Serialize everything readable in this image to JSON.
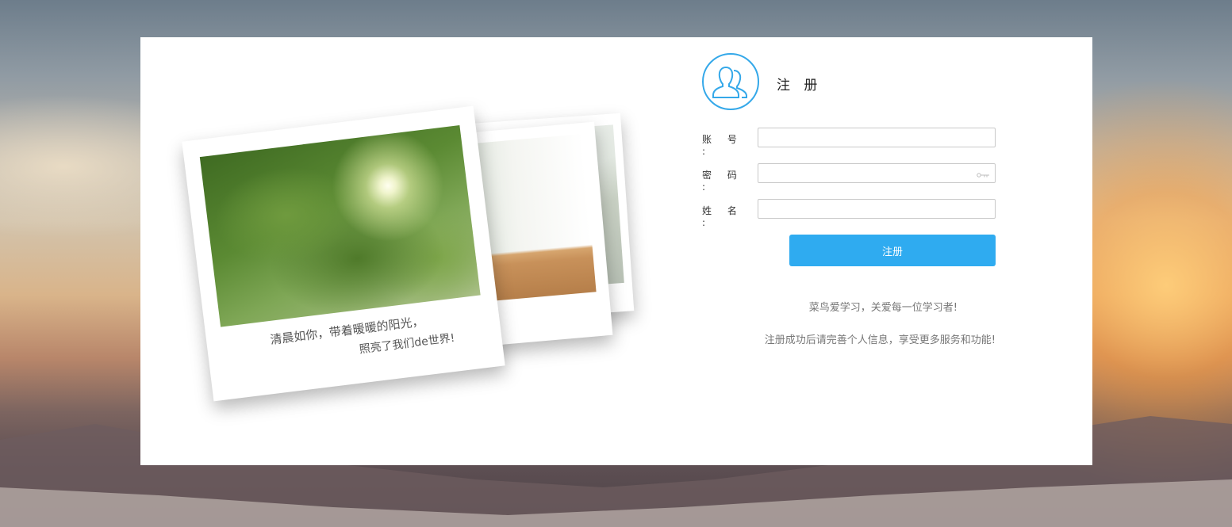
{
  "form": {
    "title": "注 册",
    "fields": [
      {
        "label": "账 号 :",
        "value": "",
        "type": "text"
      },
      {
        "label": "密 码 :",
        "value": "",
        "type": "password"
      },
      {
        "label": "姓 名 :",
        "value": "",
        "type": "text"
      }
    ],
    "submit_label": "注册"
  },
  "notes": {
    "line1": "菜鸟爱学习，关爱每一位学习者!",
    "line2": "注册成功后请完善个人信息，享受更多服务和功能!"
  },
  "photo": {
    "caption_line1": "清晨如你，带着暖暖的阳光，",
    "caption_line2": "照亮了我们de世界!"
  },
  "colors": {
    "accent": "#2fabf0",
    "avatar_stroke": "#34a8e9"
  },
  "icons": [
    "users-icon",
    "key-icon"
  ]
}
